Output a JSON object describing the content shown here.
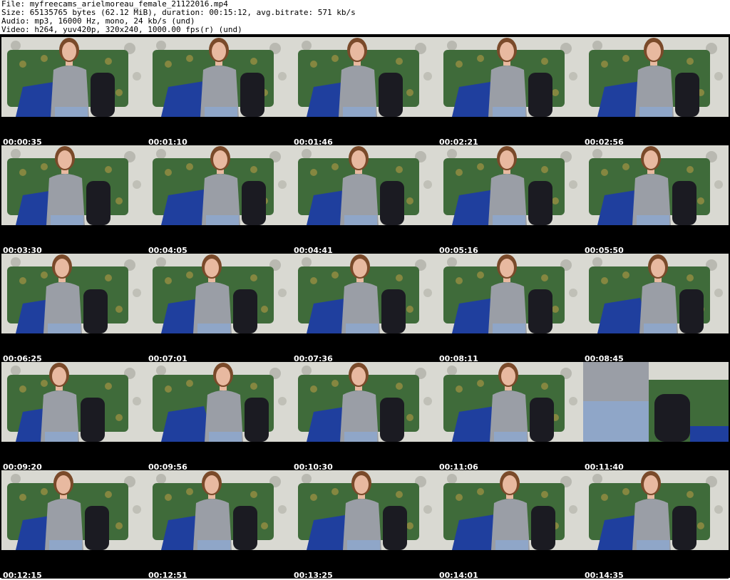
{
  "header": {
    "file_line": "File: myfreecams_arielmoreau_female_21122016.mp4",
    "size_line": "Size: 65135765 bytes (62.12 MiB), duration: 00:15:12, avg.bitrate: 571 kb/s",
    "audio_line": "Audio: mp3, 16000 Hz, mono, 24 kb/s (und)",
    "video_line": "Video: h264, yuv420p, 320x240, 1000.00 fps(r) (und)"
  },
  "thumbnails": [
    {
      "timestamp": "00:00:35"
    },
    {
      "timestamp": "00:01:10"
    },
    {
      "timestamp": "00:01:46"
    },
    {
      "timestamp": "00:02:21"
    },
    {
      "timestamp": "00:02:56"
    },
    {
      "timestamp": "00:03:30"
    },
    {
      "timestamp": "00:04:05"
    },
    {
      "timestamp": "00:04:41"
    },
    {
      "timestamp": "00:05:16"
    },
    {
      "timestamp": "00:05:50"
    },
    {
      "timestamp": "00:06:25"
    },
    {
      "timestamp": "00:07:01"
    },
    {
      "timestamp": "00:07:36"
    },
    {
      "timestamp": "00:08:11"
    },
    {
      "timestamp": "00:08:45"
    },
    {
      "timestamp": "00:09:20"
    },
    {
      "timestamp": "00:09:56"
    },
    {
      "timestamp": "00:10:30"
    },
    {
      "timestamp": "00:11:06"
    },
    {
      "timestamp": "00:11:40"
    },
    {
      "timestamp": "00:12:15"
    },
    {
      "timestamp": "00:12:51"
    },
    {
      "timestamp": "00:13:25"
    },
    {
      "timestamp": "00:14:01"
    },
    {
      "timestamp": "00:14:35"
    }
  ],
  "colors": {
    "wallpaper": "#d9d9d2",
    "wallpaper_pattern": "#9a9a8f",
    "sofa": "#3f6b3a",
    "sofa_pattern": "#b49a45",
    "blanket": "#1f3f9e",
    "shirt": "#9a9ea6",
    "skin": "#e8b9a0",
    "hair": "#7a4a2a",
    "jeans": "#8fa6c8",
    "chair": "#1b1b22"
  }
}
